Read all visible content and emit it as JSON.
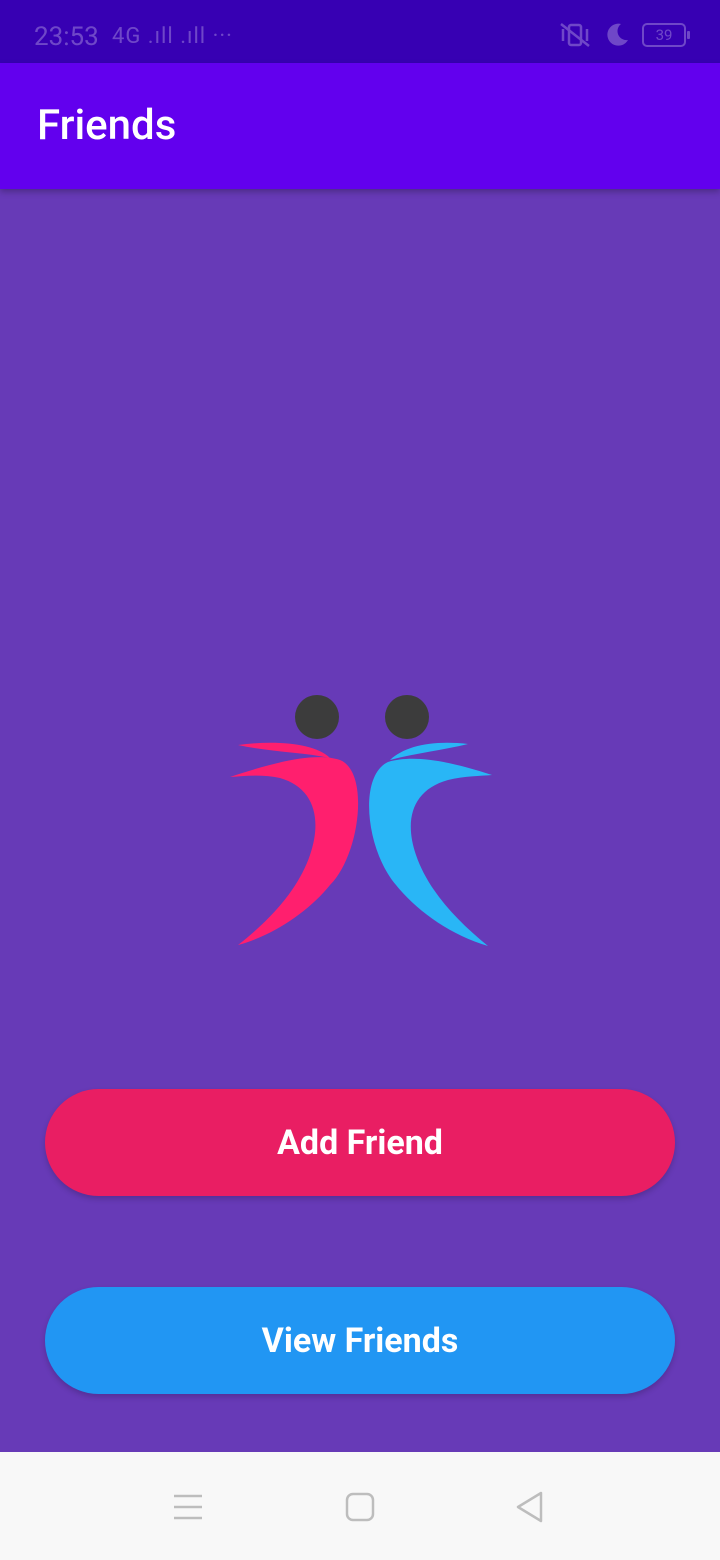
{
  "status_bar": {
    "time": "23:53",
    "network": "4G .ıll .ıll ···",
    "battery": "39",
    "icons": [
      "vibrate-icon",
      "do-not-disturb-moon-icon",
      "battery-icon"
    ]
  },
  "app_bar": {
    "title": "Friends"
  },
  "logo": {
    "name": "friends-logo",
    "colors": {
      "left_figure": "#ff1f6e",
      "right_figure": "#29b6f6",
      "heads": "#3c3c3c"
    }
  },
  "actions": {
    "add_friend_label": "Add Friend",
    "view_friends_label": "View Friends"
  },
  "nav_bar": {
    "icons": [
      "menu-icon",
      "home-icon",
      "back-icon"
    ]
  },
  "colors": {
    "status_bar": "#3700b3",
    "app_bar": "#6200ee",
    "background": "#673ab7",
    "add_button": "#e91e63",
    "view_button": "#2196f3",
    "nav_bar": "#f8f8f8"
  }
}
